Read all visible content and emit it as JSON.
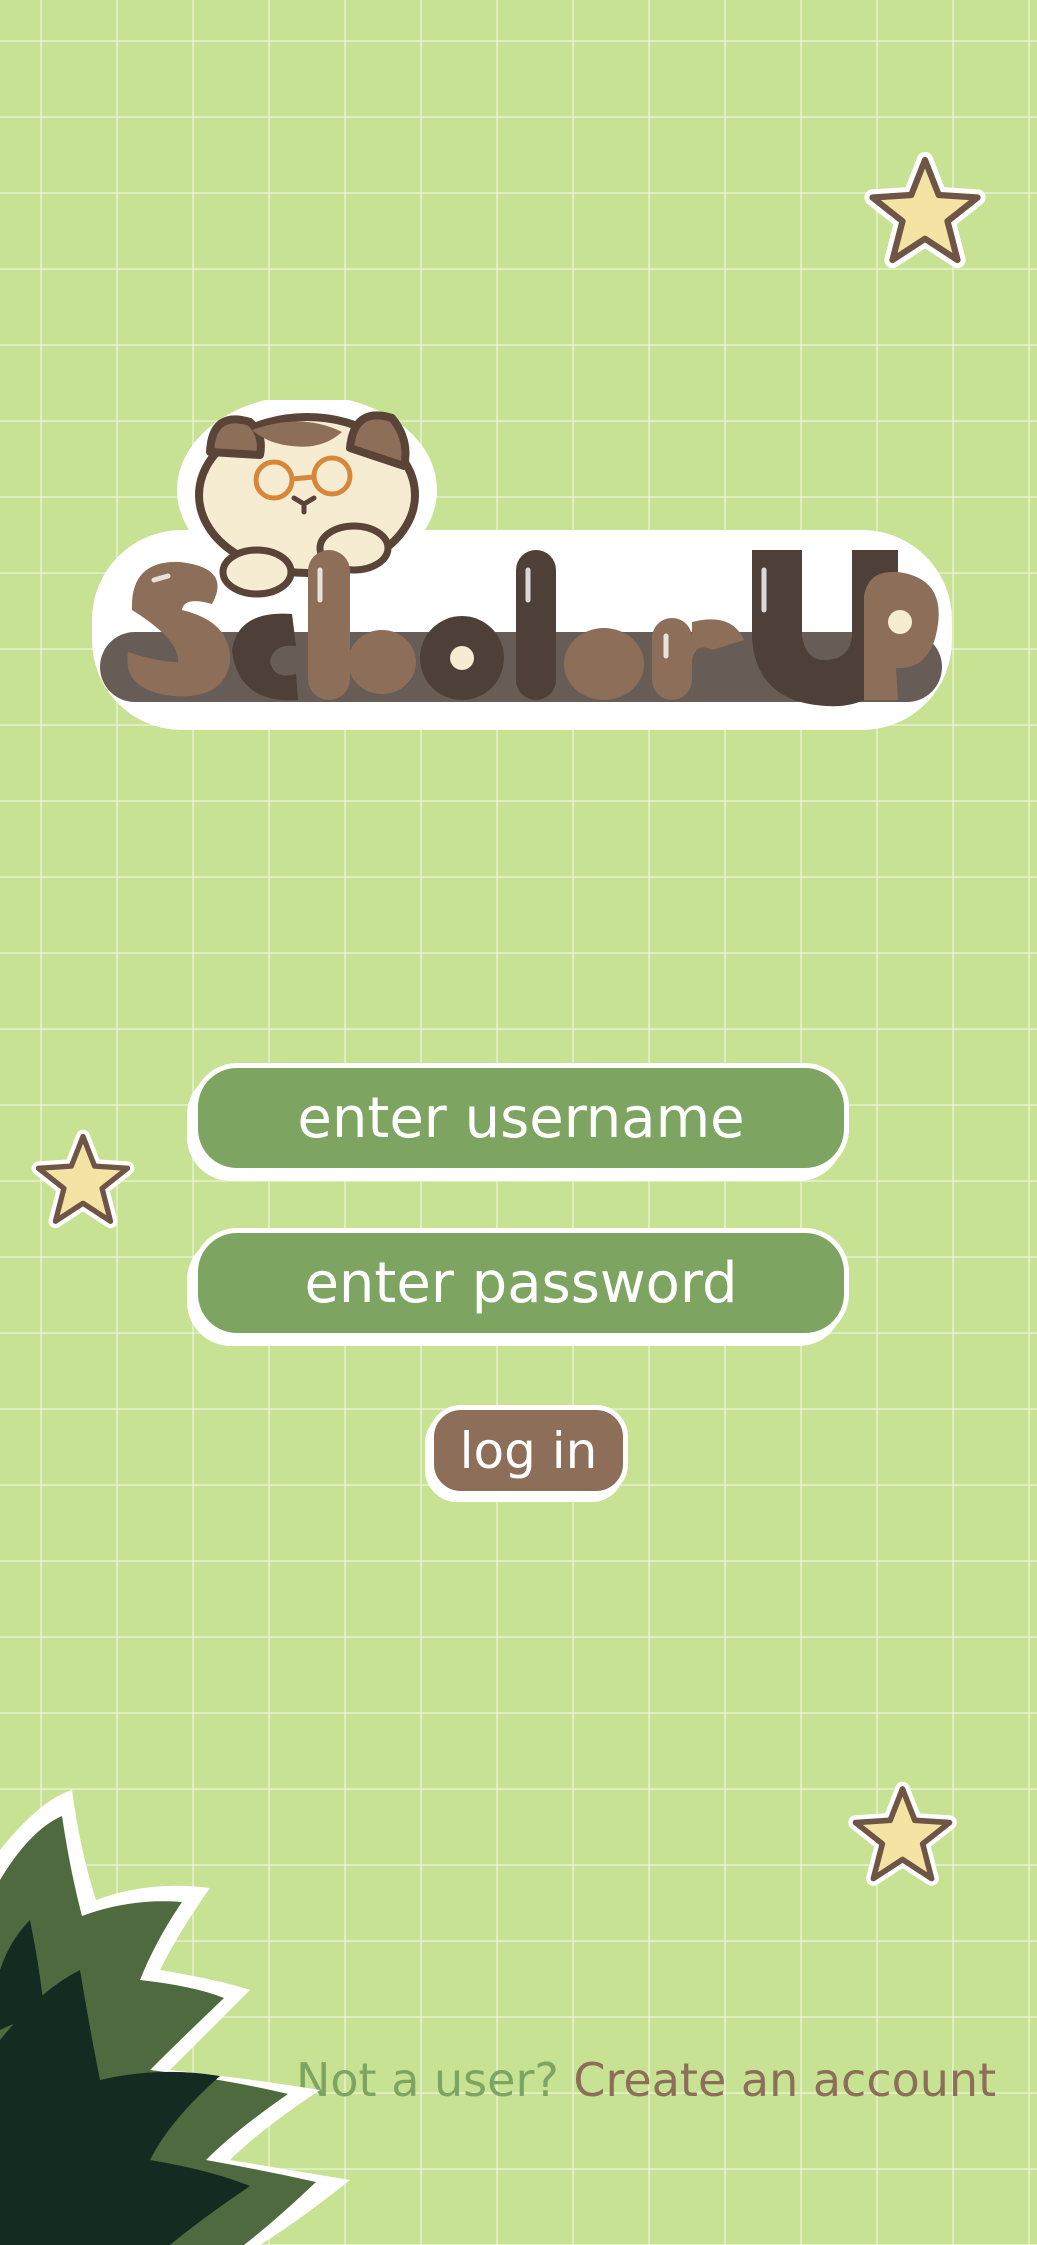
{
  "app": {
    "name": "ScholarUp"
  },
  "login_form": {
    "username_placeholder": "enter username",
    "password_placeholder": "enter password",
    "username_value": "",
    "password_value": "",
    "login_label": "log in"
  },
  "signup": {
    "prompt": "Not a user?",
    "link_label": "Create an account"
  },
  "icons": {
    "mascot": "cat-with-glasses-icon",
    "star": "star-icon",
    "foliage": "bush-leaves-icon"
  },
  "colors": {
    "background": "#c8e293",
    "grid_line": "#e4f0cc",
    "field_green": "#7ea462",
    "brown": "#8c6e59",
    "dark_brown": "#4e4038",
    "star_fill": "#f5e3a3",
    "leaf_dark": "#132b20",
    "leaf_mid": "#4e6a3e"
  }
}
